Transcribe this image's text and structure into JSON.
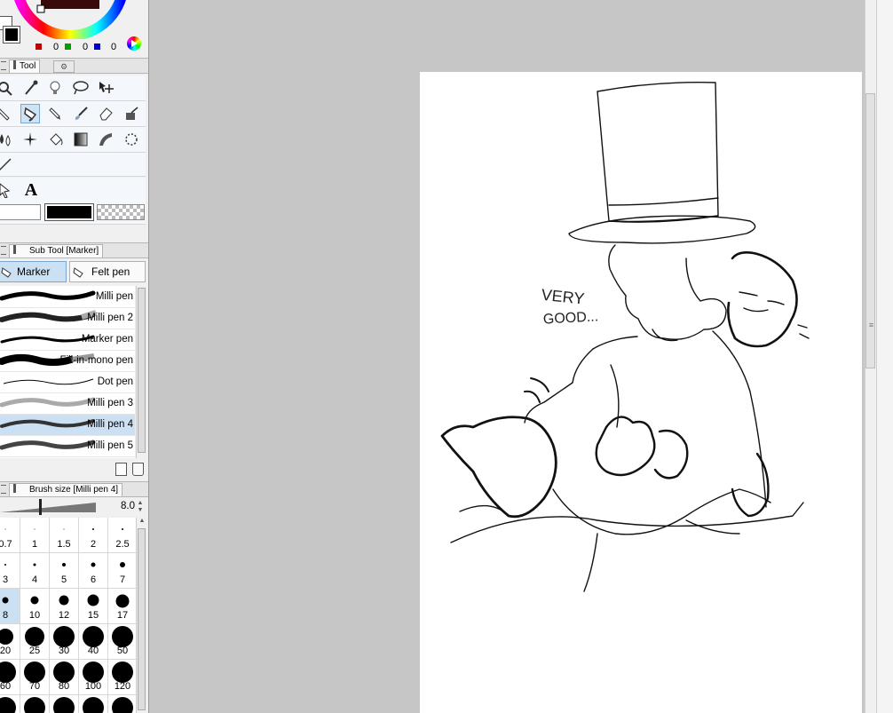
{
  "color_panel": {
    "channels": [
      {
        "color": "#c00000",
        "value": "0"
      },
      {
        "color": "#00a000",
        "value": "0"
      },
      {
        "color": "#0000c0",
        "value": "0"
      }
    ]
  },
  "tool_panel": {
    "tab_label": "Tool",
    "colors": {
      "main": "#000000",
      "sub": "#ffffff"
    }
  },
  "subtool_panel": {
    "tab_label": "Sub Tool [Marker]",
    "groups": [
      {
        "label": "Marker",
        "selected": true
      },
      {
        "label": "Felt pen",
        "selected": false
      }
    ],
    "brushes": [
      {
        "label": "Milli pen",
        "selected": false
      },
      {
        "label": "Milli pen 2",
        "selected": false
      },
      {
        "label": "Marker pen",
        "selected": false
      },
      {
        "label": "Fill-in-mono pen",
        "selected": false
      },
      {
        "label": "Dot pen",
        "selected": false
      },
      {
        "label": "Milli pen 3",
        "selected": false
      },
      {
        "label": "Milli pen 4",
        "selected": true
      },
      {
        "label": "Milli pen 5",
        "selected": false
      }
    ]
  },
  "brush_size_panel": {
    "tab_label": "Brush size [Milli pen 4]",
    "current_value": "8.0",
    "slider_fraction": 0.42,
    "sizes": [
      {
        "label": "0.7"
      },
      {
        "label": "1"
      },
      {
        "label": "1.5"
      },
      {
        "label": "2"
      },
      {
        "label": "2.5"
      },
      {
        "label": "3"
      },
      {
        "label": "4"
      },
      {
        "label": "5"
      },
      {
        "label": "6"
      },
      {
        "label": "7"
      },
      {
        "label": "8",
        "selected": true
      },
      {
        "label": "10"
      },
      {
        "label": "12"
      },
      {
        "label": "15"
      },
      {
        "label": "17"
      },
      {
        "label": "20"
      },
      {
        "label": "25"
      },
      {
        "label": "30"
      },
      {
        "label": "40"
      },
      {
        "label": "50"
      },
      {
        "label": "60"
      },
      {
        "label": "70"
      },
      {
        "label": "80"
      },
      {
        "label": "100"
      },
      {
        "label": "120"
      },
      {
        "label": ""
      },
      {
        "label": ""
      },
      {
        "label": ""
      },
      {
        "label": ""
      },
      {
        "label": ""
      }
    ]
  },
  "canvas": {
    "speech_line1": "VERY",
    "speech_line2": "GOOD..."
  }
}
